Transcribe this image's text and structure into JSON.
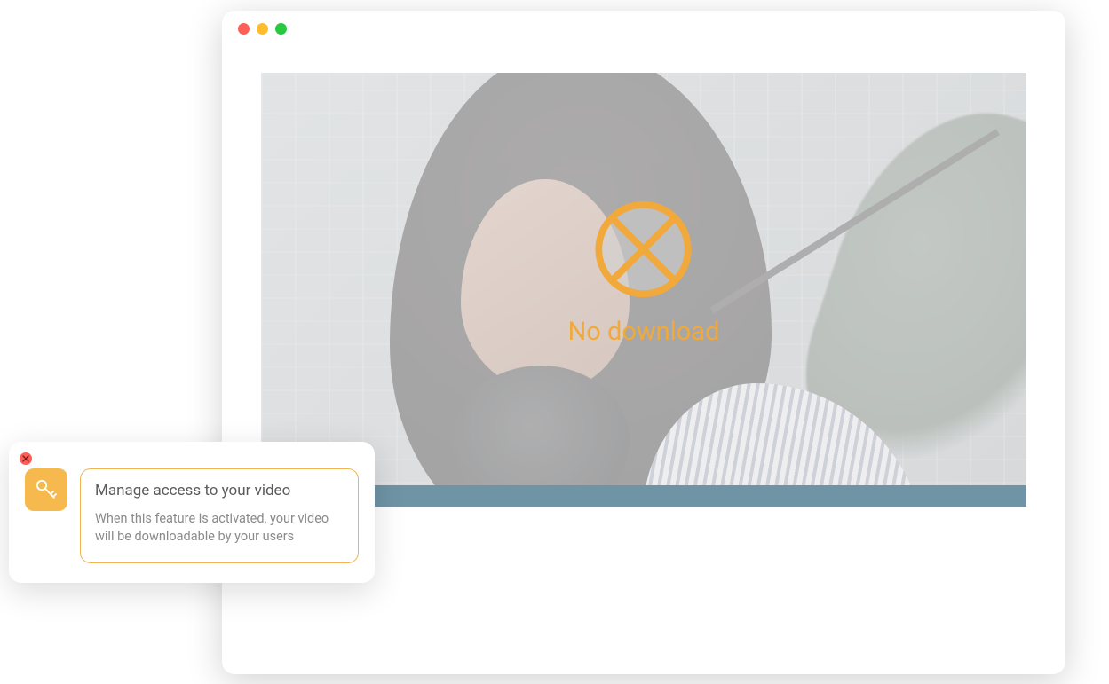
{
  "browser": {
    "traffic_lights": [
      "close",
      "minimize",
      "expand"
    ]
  },
  "video": {
    "overlay_label": "No download",
    "overlay_icon": "circle-cross-icon"
  },
  "popup": {
    "close_icon": "close-icon",
    "icon": "key-icon",
    "title": "Manage access to your video",
    "description": "When this feature is activated, your video will be downloadable by your users"
  },
  "colors": {
    "accent": "#f0a93a",
    "accent_fill": "#f6b94d"
  }
}
